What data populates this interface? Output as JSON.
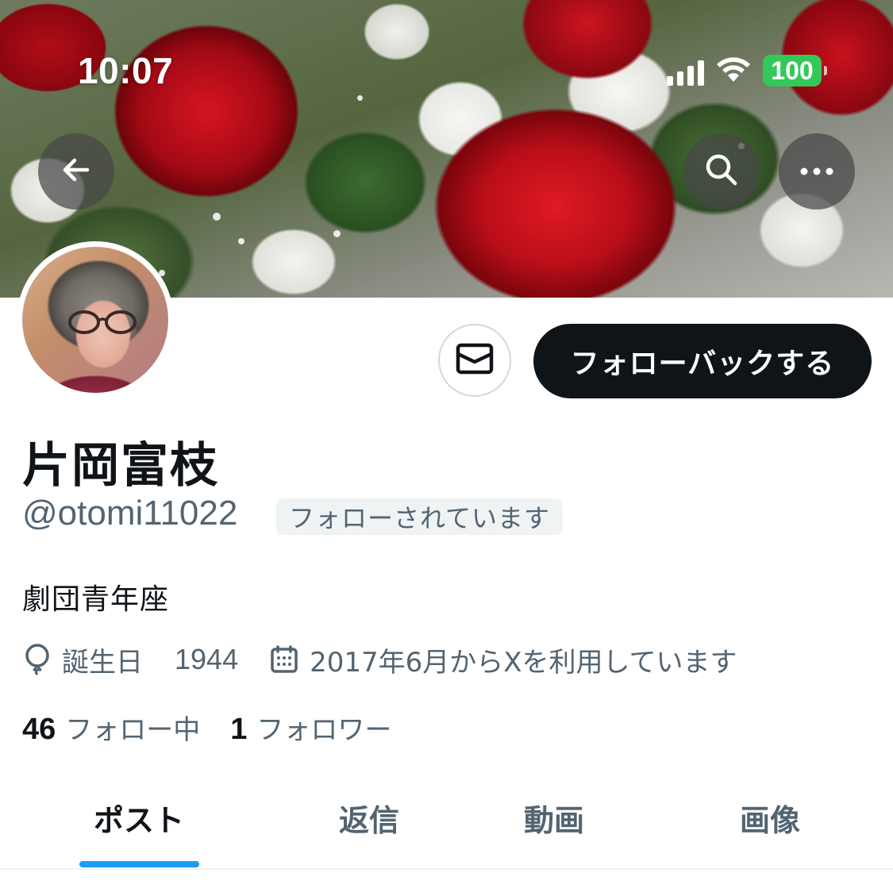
{
  "status_bar": {
    "time": "10:07",
    "battery": "100",
    "battery_color": "#34c759"
  },
  "header": {
    "back_icon": "arrow-left-icon",
    "search_icon": "search-icon",
    "more_icon": "more-horizontal-icon"
  },
  "profile": {
    "display_name": "片岡富枝",
    "handle": "@otomi11022",
    "follows_you_badge": "フォローされています",
    "bio": "劇団青年座",
    "birthday_label": "誕生日",
    "birthday_year": "1944",
    "joined": "2017年6月からXを利用しています",
    "following_count": "46",
    "following_label": "フォロー中",
    "followers_count": "1",
    "followers_label": "フォロワー"
  },
  "actions": {
    "message_icon": "envelope-icon",
    "follow_back_label": "フォローバックする"
  },
  "tabs": [
    {
      "label": "ポスト",
      "active": true
    },
    {
      "label": "返信",
      "active": false
    },
    {
      "label": "動画",
      "active": false
    },
    {
      "label": "画像",
      "active": false
    }
  ],
  "colors": {
    "accent": "#1d9bf0",
    "text_primary": "#0f1419",
    "text_secondary": "#536471"
  }
}
